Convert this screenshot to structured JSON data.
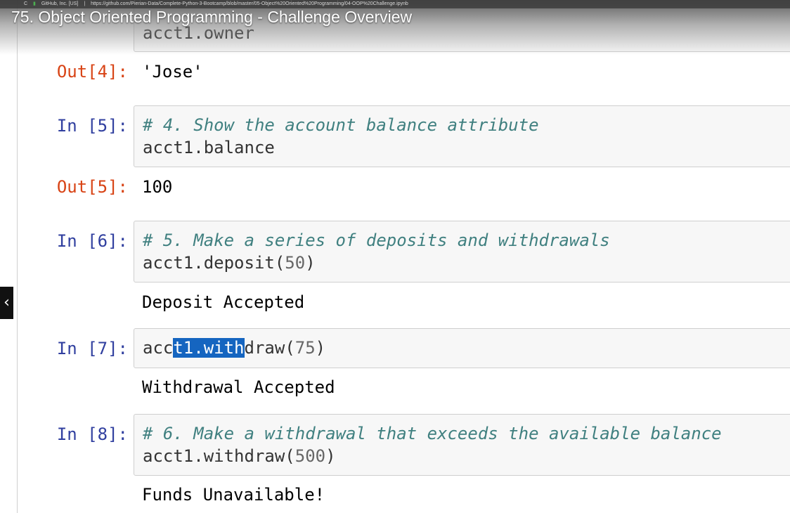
{
  "video": {
    "title": "75. Object Oriented Programming - Challenge Overview"
  },
  "browser": {
    "reload_icon": "C",
    "lock_icon": "▮",
    "site_badge": "GitHub, Inc. [US]",
    "separator": "|",
    "url": "https://github.com/Pierian-Data/Complete-Python-3-Bootcamp/blob/master/05-Object%20Oriented%20Programming/04-OOP%20Challenge.ipynb"
  },
  "side_nav": {
    "prev_icon": "‹"
  },
  "cells": {
    "c4": {
      "code_line": "acct1.owner"
    },
    "out4": {
      "prompt": "Out[4]:",
      "text": "'Jose'"
    },
    "c5": {
      "prompt": "In [5]:",
      "comment": "# 4. Show the account balance attribute",
      "code": "acct1.balance"
    },
    "out5": {
      "prompt": "Out[5]:",
      "text": "100"
    },
    "c6": {
      "prompt": "In [6]:",
      "comment": "# 5. Make a series of deposits and withdrawals",
      "code_pre": "acct1.deposit(",
      "code_num": "50",
      "code_post": ")",
      "output": "Deposit Accepted"
    },
    "c7": {
      "prompt": "In [7]:",
      "code_a": "acc",
      "code_selected": "t1.with",
      "code_b": "draw(",
      "code_num": "75",
      "code_post": ")",
      "output": "Withdrawal Accepted"
    },
    "c8": {
      "prompt": "In [8]:",
      "comment": "# 6. Make a withdrawal that exceeds the available balance",
      "code_pre": "acct1.withdraw(",
      "code_num": "500",
      "code_post": ")",
      "output": "Funds Unavailable!"
    }
  }
}
